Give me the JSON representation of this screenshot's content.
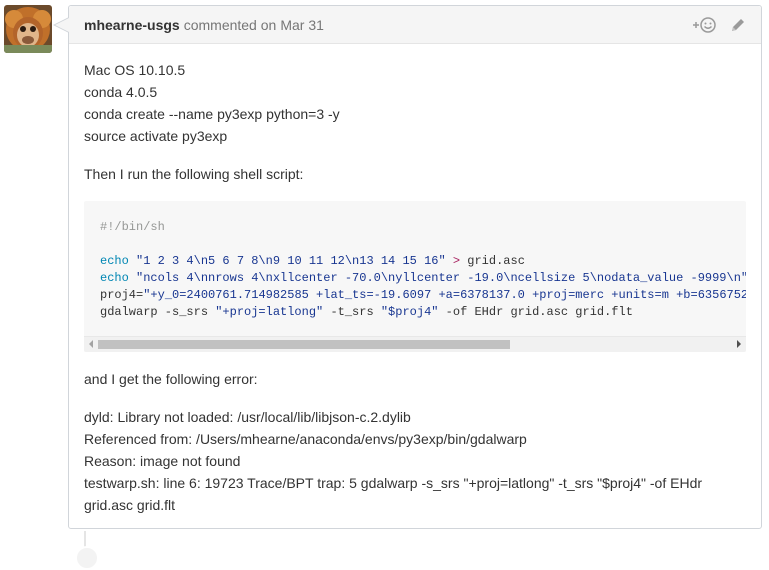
{
  "comment": {
    "author": "mhearne-usgs",
    "action_text": "commented on",
    "date": "Mar 31",
    "add_reaction_icon": "smiley-plus-icon",
    "edit_icon": "pencil-icon"
  },
  "body": {
    "env_lines": [
      "Mac OS 10.10.5",
      "conda 4.0.5",
      "conda create --name py3exp python=3 -y",
      "source activate py3exp"
    ],
    "intro": "Then I run the following shell script:",
    "code": {
      "shebang": "#!/bin/sh",
      "line1_kw": "echo",
      "line1_str": "\"1 2 3 4\\n5 6 7 8\\n9 10 11 12\\n13 14 15 16\"",
      "line1_op": ">",
      "line1_rest": "grid.asc",
      "line2_kw": "echo",
      "line2_str": "\"ncols 4\\nnrows 4\\nxllcenter -70.0\\nyllcenter -19.0\\ncellsize 5\\nodata_value -9999\\n\"",
      "line3_var": "proj4=",
      "line3_str": "\"+y_0=2400761.714982585 +lat_ts=-19.6097 +a=6378137.0 +proj=merc +units=m +b=6356752",
      "line4_cmd": "gdalwarp -s_srs ",
      "line4_str1": "\"+proj=latlong\"",
      "line4_mid": " -t_srs ",
      "line4_str2": "\"$proj4\"",
      "line4_rest": " -of EHdr grid.asc grid.flt"
    },
    "error_intro": "and I get the following error:",
    "error_lines": [
      "dyld: Library not loaded: /usr/local/lib/libjson-c.2.dylib",
      "Referenced from: /Users/mhearne/anaconda/envs/py3exp/bin/gdalwarp",
      "Reason: image not found",
      "testwarp.sh: line 6: 19723 Trace/BPT trap: 5 gdalwarp -s_srs \"+proj=latlong\" -t_srs \"$proj4\" -of EHdr grid.asc grid.flt"
    ]
  },
  "colors": {
    "border": "#d1d5da",
    "header_bg": "#f5f5f5",
    "code_bg": "#f7f7f7",
    "code_keyword": "#0086b3",
    "code_string": "#183691"
  }
}
